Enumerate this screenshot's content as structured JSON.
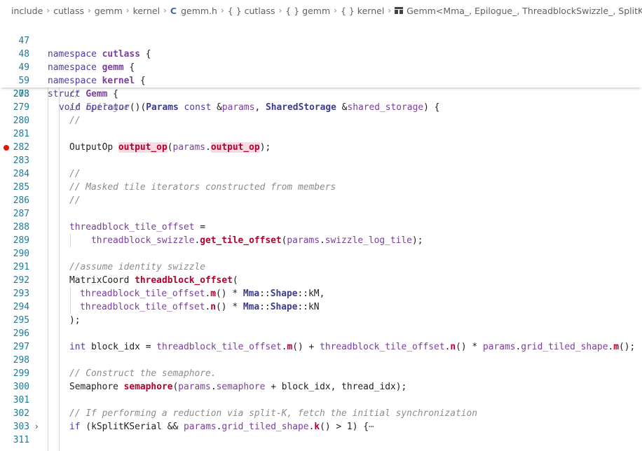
{
  "breadcrumb": {
    "items": [
      "include",
      "cutlass",
      "gemm",
      "kernel"
    ],
    "file": "gemm.h",
    "scopes": [
      "{ } cutlass",
      "{ } gemm",
      "{ } kernel"
    ],
    "symbol": "Gemm<Mma_, Epilogue_, ThreadblockSwizzle_, SplitKSerial>"
  },
  "sticky": [
    {
      "n": "47",
      "kw": "namespace",
      "name": "cutlass",
      "tail": " {"
    },
    {
      "n": "48",
      "kw": "namespace",
      "name": "gemm",
      "tail": " {"
    },
    {
      "n": "49",
      "kw": "namespace",
      "name": "kernel",
      "tail": " {"
    },
    {
      "n": "59",
      "kw": "struct",
      "name": "Gemm",
      "tail": " {"
    },
    {
      "n": "203",
      "text": "void operator()(Params const &params, SharedStorage &shared_storage) {"
    }
  ],
  "lines": [
    {
      "n": "278",
      "text": "//"
    },
    {
      "n": "279",
      "text": "// Epilogue"
    },
    {
      "n": "280",
      "text": "//"
    },
    {
      "n": "281",
      "text": ""
    },
    {
      "n": "282",
      "text": "OutputOp output_op(params.output_op);"
    },
    {
      "n": "283",
      "text": ""
    },
    {
      "n": "284",
      "text": "//"
    },
    {
      "n": "285",
      "text": "// Masked tile iterators constructed from members"
    },
    {
      "n": "286",
      "text": "//"
    },
    {
      "n": "287",
      "text": ""
    },
    {
      "n": "288",
      "text": "threadblock_tile_offset ="
    },
    {
      "n": "289",
      "text": "threadblock_swizzle.get_tile_offset(params.swizzle_log_tile);"
    },
    {
      "n": "290",
      "text": ""
    },
    {
      "n": "291",
      "text": "//assume identity swizzle"
    },
    {
      "n": "292",
      "text": "MatrixCoord threadblock_offset("
    },
    {
      "n": "293",
      "text": "threadblock_tile_offset.m() * Mma::Shape::kM,"
    },
    {
      "n": "294",
      "text": "threadblock_tile_offset.n() * Mma::Shape::kN"
    },
    {
      "n": "295",
      "text": ");"
    },
    {
      "n": "296",
      "text": ""
    },
    {
      "n": "297",
      "text": "int block_idx = threadblock_tile_offset.m() + threadblock_tile_offset.n() * params.grid_tiled_shape.m();"
    },
    {
      "n": "298",
      "text": ""
    },
    {
      "n": "299",
      "text": "// Construct the semaphore."
    },
    {
      "n": "300",
      "text": "Semaphore semaphore(params.semaphore + block_idx, thread_idx);"
    },
    {
      "n": "301",
      "text": ""
    },
    {
      "n": "302",
      "text": "// If performing a reduction via split-K, fetch the initial synchronization"
    },
    {
      "n": "303",
      "text": "if (kSplitKSerial && params.grid_tiled_shape.k() > 1) {⋯"
    },
    {
      "n": "311",
      "text": ""
    }
  ],
  "colors": {
    "line_number": "#237893",
    "breakpoint": "#e51400",
    "keyword": "#4a3f9e",
    "comment": "#8c8c8c",
    "highlight": "#f6dbe2"
  }
}
